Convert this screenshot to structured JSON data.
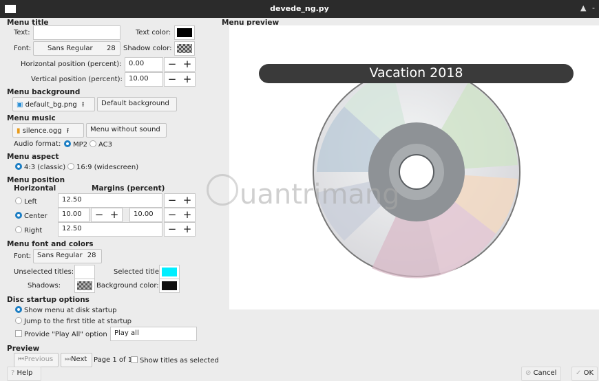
{
  "window": {
    "title": "devede_ng.py",
    "btn_up": "▲",
    "btn_min": "-"
  },
  "menu_title": {
    "section": "Menu title",
    "text_label": "Text:",
    "text_value": "",
    "text_color_label": "Text color:",
    "font_label": "Font:",
    "font_name": "Sans Regular",
    "font_size": "28",
    "shadow_color_label": "Shadow color:",
    "hpos_label": "Horizontal position (percent):",
    "hpos_value": "0.00",
    "vpos_label": "Vertical position (percent):",
    "vpos_value": "10.00"
  },
  "menu_background": {
    "section": "Menu background",
    "file": "default_bg.png",
    "default_btn": "Default background"
  },
  "menu_music": {
    "section": "Menu music",
    "file": "silence.ogg",
    "nosound_btn": "Menu without sound",
    "audio_format_label": "Audio format:",
    "opt_mp2": "MP2",
    "opt_ac3": "AC3"
  },
  "menu_aspect": {
    "section": "Menu aspect",
    "opt_43": "4:3 (classic)",
    "opt_169": "16:9 (widescreen)"
  },
  "menu_position": {
    "section": "Menu position",
    "horizontal": "Horizontal",
    "margins": "Margins (percent)",
    "left_label": "Left",
    "left_value": "12.50",
    "center_label": "Center",
    "center_value1": "10.00",
    "center_value2": "10.00",
    "right_label": "Right",
    "right_value": "12.50"
  },
  "menu_font": {
    "section": "Menu font and colors",
    "font_label": "Font:",
    "font_name": "Sans Regular",
    "font_size": "28",
    "unselected_label": "Unselected titles:",
    "selected_label": "Selected title:",
    "shadows_label": "Shadows:",
    "bgcolor_label": "Background color:"
  },
  "disc_startup": {
    "section": "Disc startup options",
    "opt_show": "Show menu at disk startup",
    "opt_jump": "Jump to the first title at startup",
    "playall_label": "Provide \"Play All\" option",
    "playall_value": "Play all"
  },
  "preview": {
    "section": "Preview",
    "prev_btn": "Previous",
    "next_btn": "Next",
    "page_text": "Page 1 of 1",
    "show_titles": "Show titles as selected"
  },
  "menu_preview": {
    "label": "Menu preview",
    "title": "Vacation 2018"
  },
  "watermark": "uantrimang",
  "footer": {
    "help_btn": "Help",
    "cancel_btn": "Cancel",
    "ok_btn": "OK"
  },
  "colors": {
    "text_color": "#000000",
    "selected_title": "#00eeff",
    "bg_color": "#111111",
    "radio_on": "#1c7ec4"
  }
}
